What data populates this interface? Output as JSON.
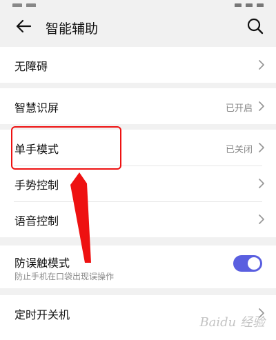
{
  "header": {
    "title": "智能辅助"
  },
  "icons": {
    "back": "back-arrow-icon",
    "search": "search-icon",
    "chevron": "chevron-right-icon"
  },
  "sections": {
    "accessibility": {
      "label": "无障碍"
    },
    "smart_screen": {
      "label": "智慧识屏",
      "status": "已开启"
    },
    "one_hand": {
      "label": "单手模式",
      "status": "已关闭"
    },
    "gesture": {
      "label": "手势控制"
    },
    "voice": {
      "label": "语音控制"
    },
    "pocket_mode": {
      "label": "防误触模式",
      "sublabel": "防止手机在口袋出现误操作",
      "enabled": true
    },
    "schedule_power": {
      "label": "定时开关机"
    }
  },
  "watermark": {
    "text": "Baidu 经验"
  },
  "colors": {
    "toggle_on": "#5a5fe0",
    "annotation": "#e11111"
  }
}
